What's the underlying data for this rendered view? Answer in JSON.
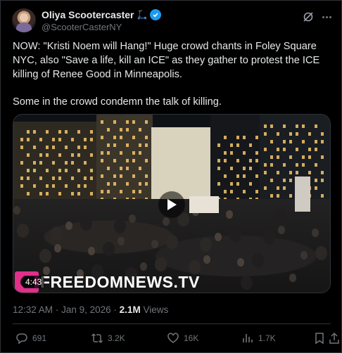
{
  "author": {
    "display_name": "Oliya Scootercaster",
    "emoji": "🛴",
    "handle": "@ScooterCasterNY",
    "verified": true
  },
  "post": {
    "paragraphs": [
      "NOW: \"Kristi Noem will Hang!\" Huge crowd chants in Foley Square NYC, also \"Save a life, kill an ICE\" as they gather to protest the ICE killing of Renee Good in Minneapolis.",
      "Some in the crowd condemn the talk of killing."
    ]
  },
  "media": {
    "watermark": "FREEDOMNEWS.TV",
    "duration": "4:43",
    "icon": "play-icon"
  },
  "meta": {
    "time": "12:32 AM",
    "date": "Jan 9, 2026",
    "separator": "·",
    "views_count": "2.1M",
    "views_label": "Views"
  },
  "actions": {
    "replies": "691",
    "reposts": "3.2K",
    "likes": "16K",
    "views": "1.7K"
  },
  "colors": {
    "background": "#000000",
    "text": "#e7e9ea",
    "muted": "#71767b",
    "verified": "#1d9bf0",
    "watermark_logo": "#e0308a"
  }
}
